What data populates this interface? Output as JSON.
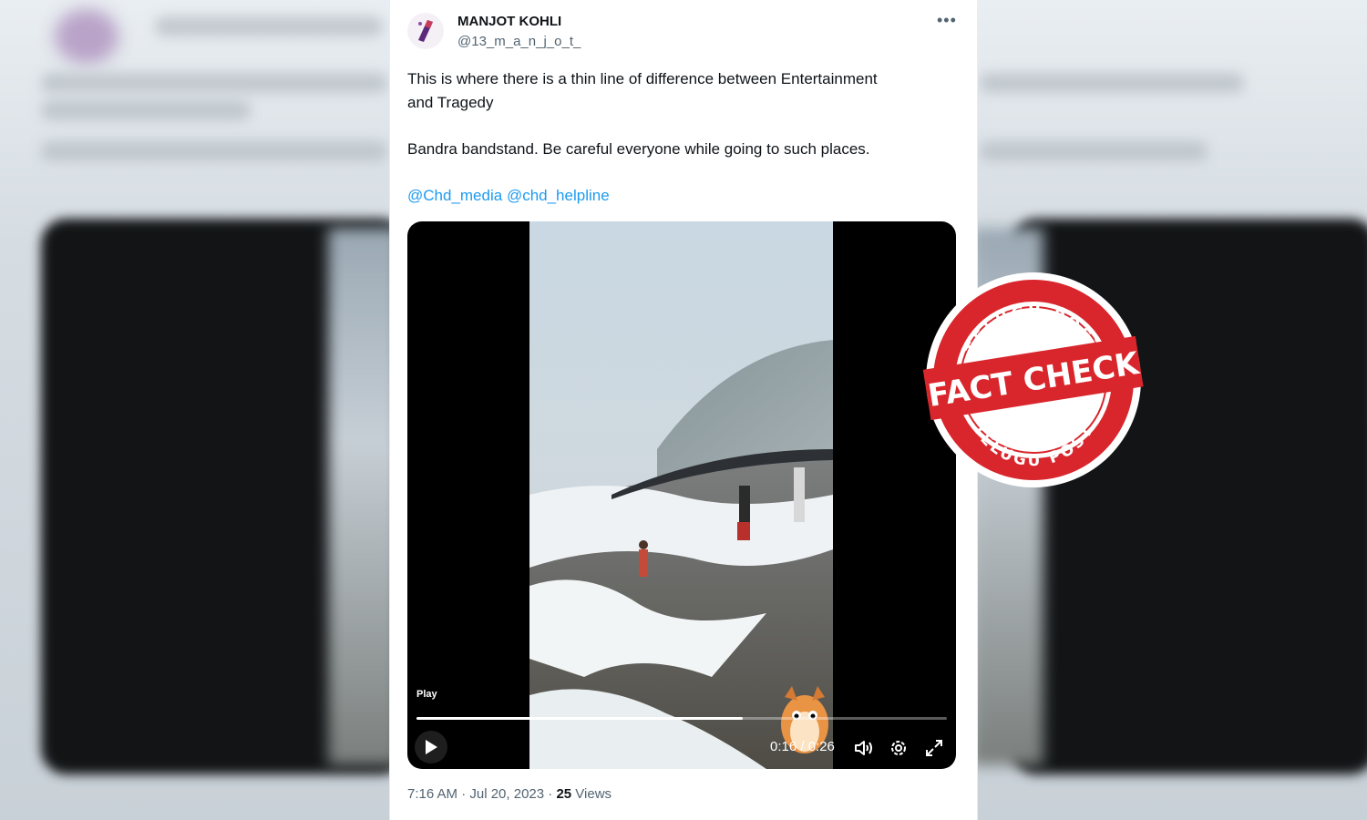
{
  "author": {
    "name": "MANJOT KOHLI",
    "handle": "@13_m_a_n_j_o_t_"
  },
  "tweet": {
    "line1": "This is where there is a thin line of difference between Entertainment",
    "line2": "and Tragedy",
    "line3": "Bandra bandstand. Be careful everyone while going to such places.",
    "mentions": [
      "@Chd_media",
      "@chd_helpline"
    ]
  },
  "video": {
    "play_label": "Play",
    "time_display": "0:16 / 0:26",
    "progress_fraction": 0.6154
  },
  "meta": {
    "time": "7:16 AM · Jul 20, 2023 · ",
    "views_count": "25",
    "views_label": " Views"
  },
  "stamp": {
    "top_text": "TELUGU POST",
    "middle_text": "FACT CHECK",
    "bottom_text": "TELUGU POST"
  },
  "colors": {
    "link": "#1d9bf0",
    "stamp_red": "#d8262c"
  },
  "icons": [
    "more-icon",
    "play-icon",
    "volume-icon",
    "settings-icon",
    "fullscreen-icon"
  ]
}
